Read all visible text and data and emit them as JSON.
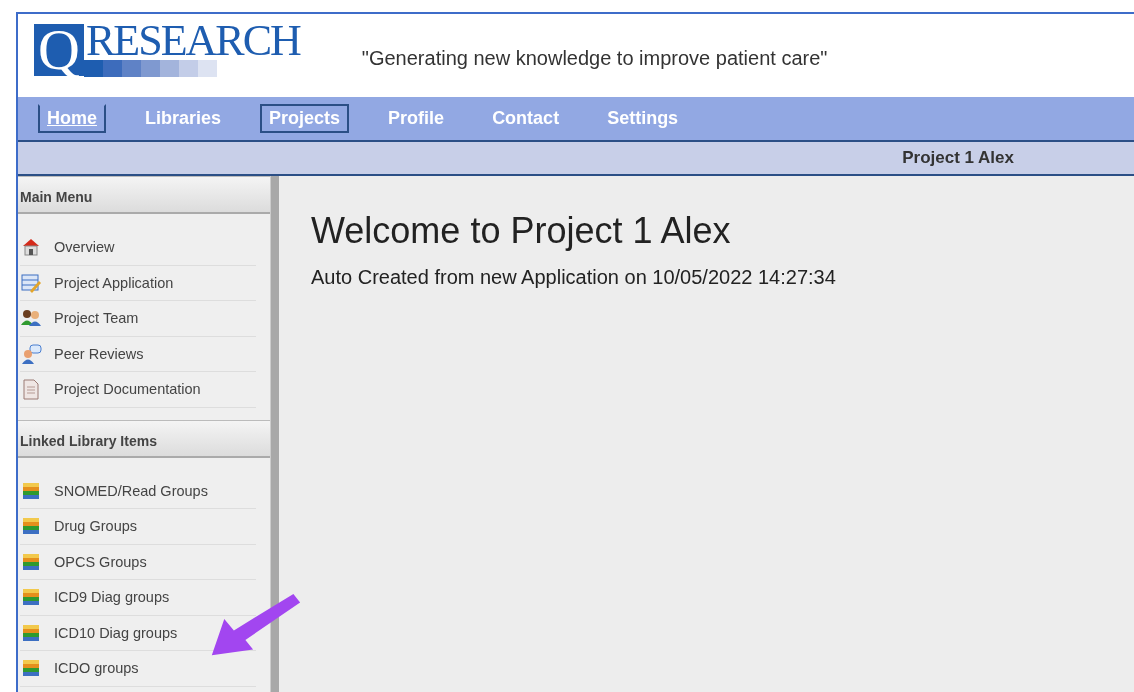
{
  "header": {
    "logo_letter": "Q",
    "logo_text": "RESEARCH",
    "tagline": "\"Generating new knowledge to improve patient care\""
  },
  "nav": [
    {
      "label": "Home",
      "selected": false,
      "focused": true
    },
    {
      "label": "Libraries",
      "selected": false,
      "focused": false
    },
    {
      "label": "Projects",
      "selected": true,
      "focused": false
    },
    {
      "label": "Profile",
      "selected": false,
      "focused": false
    },
    {
      "label": "Contact",
      "selected": false,
      "focused": false
    },
    {
      "label": "Settings",
      "selected": false,
      "focused": false
    }
  ],
  "context_bar": {
    "project": "Project 1 Alex"
  },
  "sidebar": {
    "sections": [
      {
        "title": "Main Menu",
        "items": [
          {
            "label": "Overview",
            "kind": "home"
          },
          {
            "label": "Project Application",
            "kind": "form"
          },
          {
            "label": "Project Team",
            "kind": "team"
          },
          {
            "label": "Peer Reviews",
            "kind": "review"
          },
          {
            "label": "Project Documentation",
            "kind": "document"
          }
        ]
      },
      {
        "title": "Linked Library Items",
        "items": [
          {
            "label": "SNOMED/Read Groups",
            "kind": "library"
          },
          {
            "label": "Drug Groups",
            "kind": "library"
          },
          {
            "label": "OPCS Groups",
            "kind": "library"
          },
          {
            "label": "ICD9 Diag groups",
            "kind": "library"
          },
          {
            "label": "ICD10 Diag groups",
            "kind": "library"
          },
          {
            "label": "ICDO groups",
            "kind": "library"
          }
        ]
      }
    ]
  },
  "main": {
    "heading": "Welcome to Project 1 Alex",
    "subtitle": "Auto Created from new Application on 10/05/2022 14:27:34"
  }
}
